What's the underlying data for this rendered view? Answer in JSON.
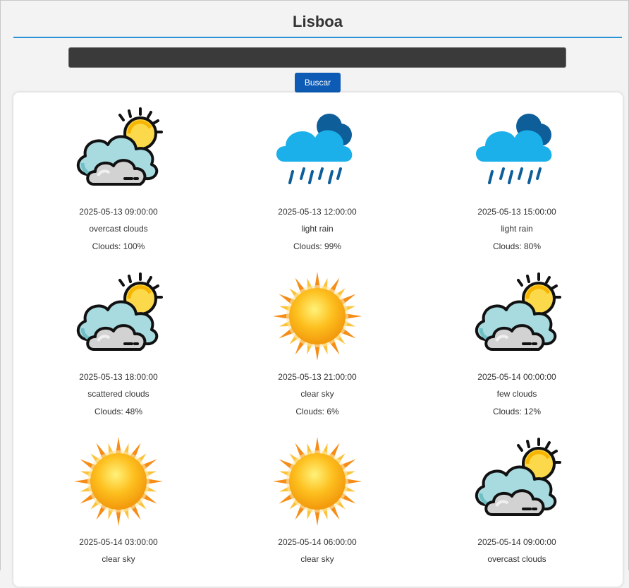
{
  "city": "Lisboa",
  "search": {
    "value": "",
    "placeholder": ""
  },
  "button_label": "Buscar",
  "colors": {
    "accent": "#2a93d5",
    "button": "#0d5bb5",
    "input_bg": "#3a3a3a"
  },
  "forecasts": [
    {
      "datetime": "2025-05-13 09:00:00",
      "description": "overcast clouds",
      "clouds": "Clouds: 100%",
      "icon": "cloudy-sun-icon"
    },
    {
      "datetime": "2025-05-13 12:00:00",
      "description": "light rain",
      "clouds": "Clouds: 99%",
      "icon": "rain-cloud-icon"
    },
    {
      "datetime": "2025-05-13 15:00:00",
      "description": "light rain",
      "clouds": "Clouds: 80%",
      "icon": "rain-cloud-icon"
    },
    {
      "datetime": "2025-05-13 18:00:00",
      "description": "scattered clouds",
      "clouds": "Clouds: 48%",
      "icon": "cloudy-sun-icon"
    },
    {
      "datetime": "2025-05-13 21:00:00",
      "description": "clear sky",
      "clouds": "Clouds: 6%",
      "icon": "sun-icon"
    },
    {
      "datetime": "2025-05-14 00:00:00",
      "description": "few clouds",
      "clouds": "Clouds: 12%",
      "icon": "cloudy-sun-icon"
    },
    {
      "datetime": "2025-05-14 03:00:00",
      "description": "clear sky",
      "clouds": "",
      "icon": "sun-icon"
    },
    {
      "datetime": "2025-05-14 06:00:00",
      "description": "clear sky",
      "clouds": "",
      "icon": "sun-icon"
    },
    {
      "datetime": "2025-05-14 09:00:00",
      "description": "overcast clouds",
      "clouds": "",
      "icon": "cloudy-sun-icon"
    }
  ]
}
